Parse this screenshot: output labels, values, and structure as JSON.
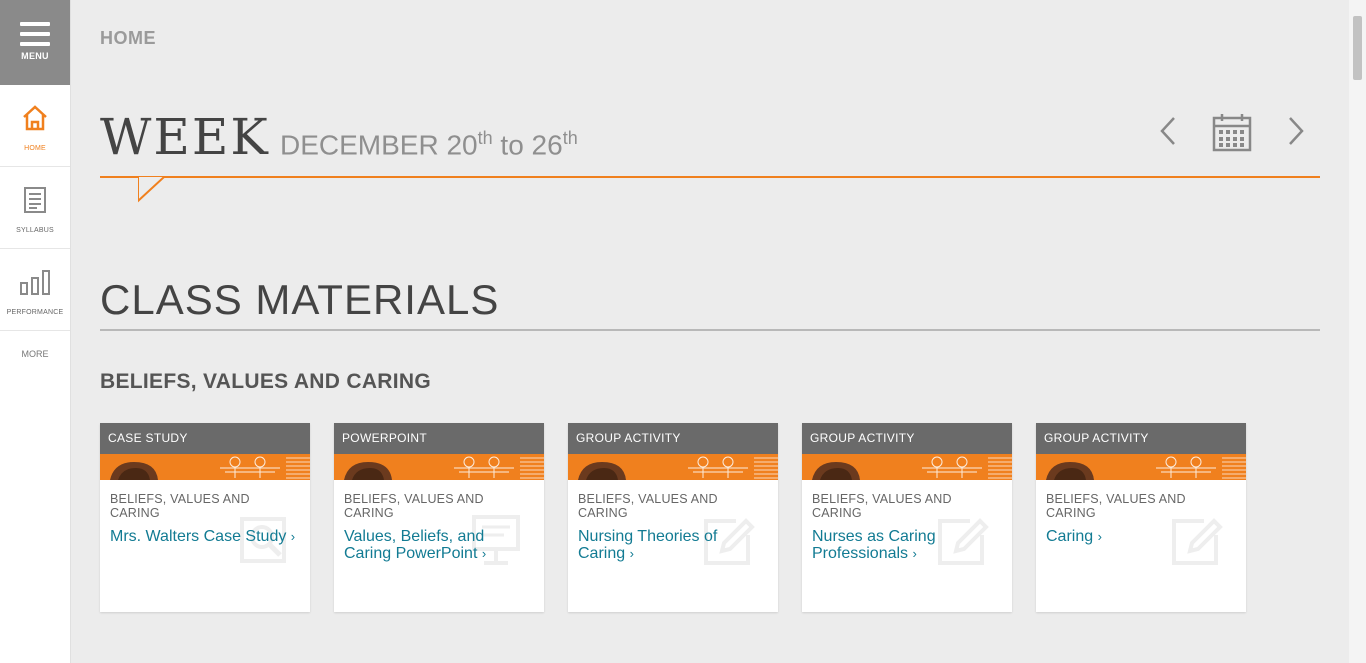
{
  "sidebar": {
    "menu_label": "MENU",
    "items": [
      {
        "label": "HOME",
        "icon": "home-icon",
        "active": true
      },
      {
        "label": "SYLLABUS",
        "icon": "syllabus-icon",
        "active": false
      },
      {
        "label": "PERFORMANCE",
        "icon": "performance-icon",
        "active": false
      }
    ],
    "more_label": "MORE"
  },
  "breadcrumb": "HOME",
  "week": {
    "title": "WEEK",
    "range_prefix": "DECEMBER 20",
    "sup1": "th",
    "range_mid": " to 26",
    "sup2": "th"
  },
  "section_title": "CLASS MATERIALS",
  "group_title": "BELIEFS, VALUES AND CARING",
  "cards": [
    {
      "type": "CASE STUDY",
      "category": "BELIEFS, VALUES AND CARING",
      "title": "Mrs. Walters Case Study",
      "icon": "magnifier-icon"
    },
    {
      "type": "POWERPOINT",
      "category": "BELIEFS, VALUES AND CARING",
      "title": "Values, Beliefs, and Caring PowerPoint",
      "icon": "presentation-icon"
    },
    {
      "type": "GROUP ACTIVITY",
      "category": "BELIEFS, VALUES AND CARING",
      "title": "Nursing Theories of Caring",
      "icon": "edit-icon"
    },
    {
      "type": "GROUP ACTIVITY",
      "category": "BELIEFS, VALUES AND CARING",
      "title": "Nurses as Caring Professionals",
      "icon": "edit-icon"
    },
    {
      "type": "GROUP ACTIVITY",
      "category": "BELIEFS, VALUES AND CARING",
      "title": "Caring",
      "icon": "edit-icon"
    }
  ],
  "colors": {
    "accent": "#f0801e",
    "link": "#127b93",
    "card_head": "#6a6a6a"
  }
}
